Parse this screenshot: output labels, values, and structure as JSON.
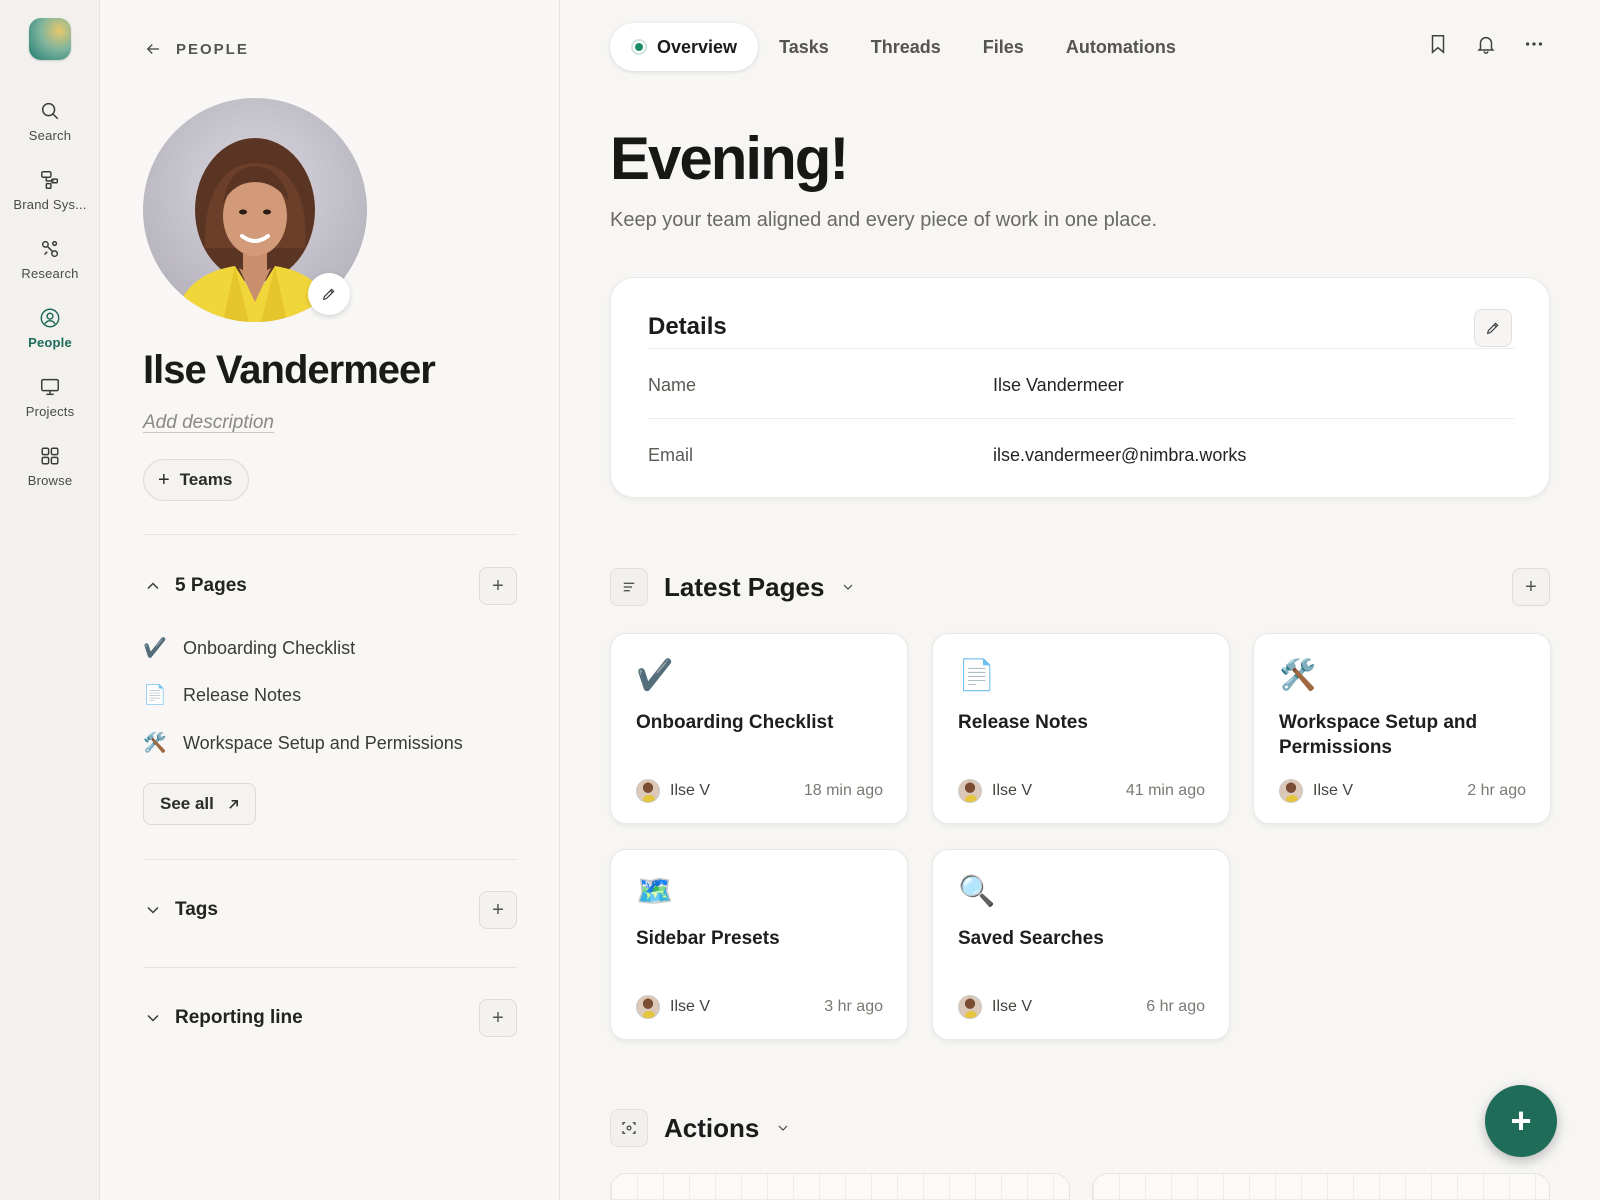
{
  "rail": {
    "items": [
      {
        "label": "Search",
        "icon": "search-icon"
      },
      {
        "label": "Brand Sys...",
        "icon": "shapes-icon"
      },
      {
        "label": "Research",
        "icon": "nodes-icon"
      },
      {
        "label": "People",
        "icon": "person-circle-icon",
        "active": true
      },
      {
        "label": "Projects",
        "icon": "monitor-icon"
      },
      {
        "label": "Browse",
        "icon": "grid-icon"
      }
    ]
  },
  "profile": {
    "back_label": "PEOPLE",
    "name": "Ilse Vandermeer",
    "description_placeholder": "Add description",
    "teams_label": "Teams",
    "pages_header": "5 Pages",
    "pages": [
      {
        "icon": "✔️",
        "title": "Onboarding Checklist"
      },
      {
        "icon": "📄",
        "title": "Release Notes"
      },
      {
        "icon": "🛠️",
        "title": "Workspace Setup and Permissions"
      }
    ],
    "see_all_label": "See all",
    "tags_header": "Tags",
    "reporting_header": "Reporting line"
  },
  "tabs": [
    {
      "label": "Overview",
      "active": true
    },
    {
      "label": "Tasks"
    },
    {
      "label": "Threads"
    },
    {
      "label": "Files"
    },
    {
      "label": "Automations"
    }
  ],
  "main": {
    "greeting": "Evening!",
    "subtitle": "Keep your team aligned and every piece of work in one place.",
    "details": {
      "title": "Details",
      "rows": [
        {
          "key": "Name",
          "value": "Ilse Vandermeer"
        },
        {
          "key": "Email",
          "value": "ilse.vandermeer@nimbra.works"
        }
      ]
    },
    "latest_pages": {
      "title": "Latest Pages",
      "cards": [
        {
          "icon": "✔️",
          "title": "Onboarding Checklist",
          "author": "Ilse V",
          "time": "18 min ago"
        },
        {
          "icon": "📄",
          "title": "Release Notes",
          "author": "Ilse V",
          "time": "41 min ago"
        },
        {
          "icon": "🛠️",
          "title": "Workspace Setup and Permissions",
          "author": "Ilse V",
          "time": "2 hr ago"
        },
        {
          "icon": "🗺️",
          "title": "Sidebar Presets",
          "author": "Ilse V",
          "time": "3 hr ago"
        },
        {
          "icon": "🔍",
          "title": "Saved Searches",
          "author": "Ilse V",
          "time": "6 hr ago"
        }
      ]
    },
    "actions_title": "Actions"
  },
  "colors": {
    "accent": "#1f6d58",
    "live": "#1e8a66",
    "background": "#f7f6f4"
  }
}
